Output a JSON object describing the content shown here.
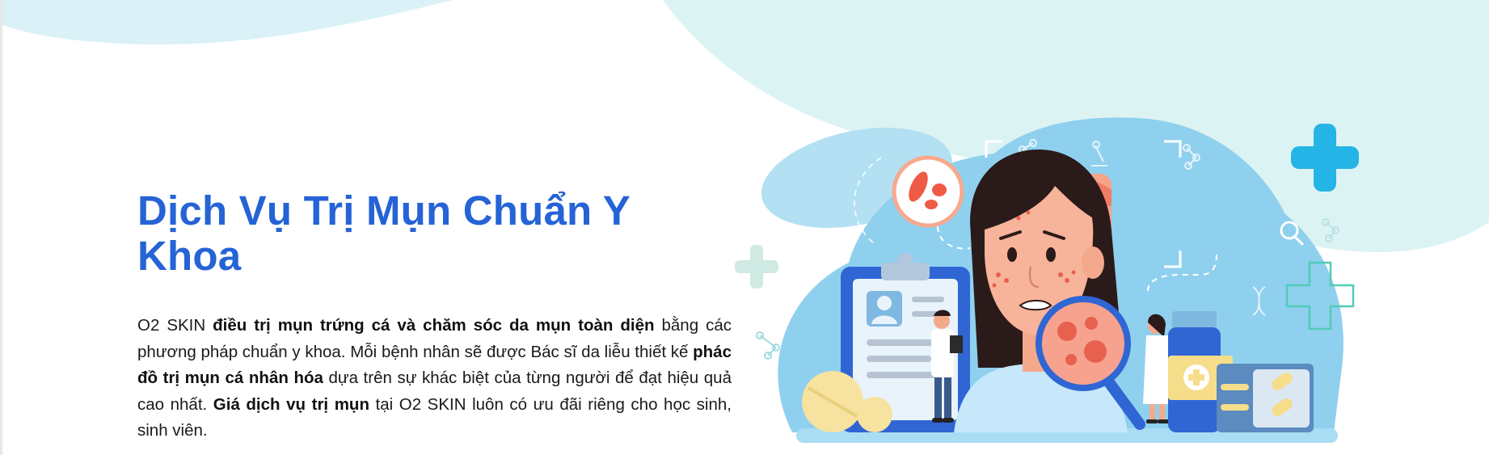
{
  "hero": {
    "title": "Dịch Vụ Trị Mụn Chuẩn Y Khoa",
    "description": [
      {
        "text": "O2 SKIN ",
        "bold": false
      },
      {
        "text": "điều trị mụn trứng cá và chăm sóc da mụn toàn diện",
        "bold": true
      },
      {
        "text": " bằng các phương pháp chuẩn y khoa. Mỗi bệnh nhân sẽ được Bác sĩ da liễu thiết kế ",
        "bold": false
      },
      {
        "text": "phác đồ trị mụn cá nhân hóa",
        "bold": true
      },
      {
        "text": " dựa trên sự khác biệt của từng người để đạt hiệu quả cao nhất. ",
        "bold": false
      },
      {
        "text": "Giá dịch vụ trị mụn",
        "bold": true
      },
      {
        "text": " tại O2 SKIN luôn có ưu đãi riêng cho học sinh, sinh viên.",
        "bold": false
      }
    ]
  },
  "colors": {
    "title": "#2563d6",
    "wave": "#dcf3f4",
    "wave_left": "#d9f1f7",
    "blob": "#8fd0ee",
    "cross": "#25b4e6"
  },
  "illustration": {
    "icons": [
      "cross-icon",
      "magnifier-icon",
      "molecule-icon",
      "dna-icon",
      "microscope-icon",
      "bacteria-icon",
      "clipboard-icon",
      "medicine-bottle-icon",
      "pill-icon"
    ]
  }
}
